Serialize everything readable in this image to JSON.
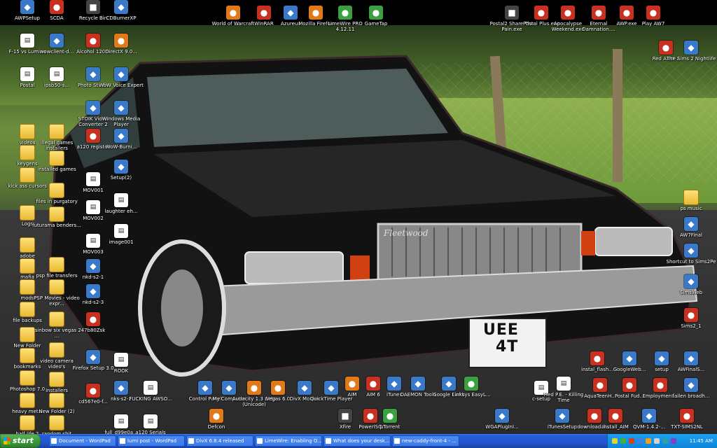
{
  "desktop": {
    "icons_left": [
      {
        "label": "AWPSetup",
        "kind": "app"
      },
      {
        "label": "SCDA",
        "kind": "red"
      },
      {
        "label": "Recycle Bin",
        "kind": "dark"
      },
      {
        "label": "CDBurnerXP",
        "kind": "app"
      },
      {
        "label": "F-15 vs Lumina",
        "kind": "doc"
      },
      {
        "label": "wowclient-d...",
        "kind": "app"
      },
      {
        "label": "Alcohol 120%",
        "kind": "red"
      },
      {
        "label": "DirectX 9.0...",
        "kind": "orange"
      },
      {
        "label": "Postal",
        "kind": "doc"
      },
      {
        "label": "ipsb50-s...",
        "kind": "doc"
      },
      {
        "label": "Photo Studio",
        "kind": "app"
      },
      {
        "label": "WoW Voice Expert",
        "kind": "app"
      },
      {
        "label": "videos",
        "kind": "folder"
      },
      {
        "label": "illegal games installers",
        "kind": "folder"
      },
      {
        "label": "STOIK Video Converter 2",
        "kind": "app"
      },
      {
        "label": "Windows Media Player",
        "kind": "app"
      },
      {
        "label": "a120 register",
        "kind": "red"
      },
      {
        "label": "WoW-Burni...",
        "kind": "app"
      },
      {
        "label": "keygens",
        "kind": "folder"
      },
      {
        "label": "installed games",
        "kind": "folder"
      },
      {
        "label": "Setup(2)",
        "kind": "app"
      },
      {
        "label": "kick ass cursors",
        "kind": "folder"
      },
      {
        "label": "files in purgatory",
        "kind": "folder"
      },
      {
        "label": "MOV001",
        "kind": "doc"
      },
      {
        "label": "laughter eh...",
        "kind": "doc"
      },
      {
        "label": "Logs",
        "kind": "folder"
      },
      {
        "label": "futurama benders...",
        "kind": "folder"
      },
      {
        "label": "MOV002",
        "kind": "doc"
      },
      {
        "label": "adobe",
        "kind": "folder"
      },
      {
        "label": "MOV003",
        "kind": "doc"
      },
      {
        "label": "image001",
        "kind": "doc"
      },
      {
        "label": "mafia",
        "kind": "folder"
      },
      {
        "label": "psp file transfers",
        "kind": "folder"
      },
      {
        "label": "nkd-s2-1",
        "kind": "app"
      },
      {
        "label": "mods",
        "kind": "folder"
      },
      {
        "label": "PSP Movies - video expr...",
        "kind": "folder"
      },
      {
        "label": "nkd-s2-3",
        "kind": "app"
      },
      {
        "label": "file backups",
        "kind": "folder"
      },
      {
        "label": "rainbow six vegas 2 ...",
        "kind": "folder"
      },
      {
        "label": "47b80Zsk",
        "kind": "red"
      },
      {
        "label": "New Folder",
        "kind": "folder"
      },
      {
        "label": "video camera video's",
        "kind": "folder"
      },
      {
        "label": "bookmarks",
        "kind": "folder"
      },
      {
        "label": "Firefox Setup 3.0",
        "kind": "app"
      },
      {
        "label": "ROOK",
        "kind": "doc"
      },
      {
        "label": "Photoshop 7.0",
        "kind": "folder"
      },
      {
        "label": "installers",
        "kind": "folder"
      },
      {
        "label": "cd567e0-f...",
        "kind": "red"
      },
      {
        "label": "nks-s2-2",
        "kind": "app"
      },
      {
        "label": "FUCKING AWSO...",
        "kind": "doc"
      },
      {
        "label": "heavy metal",
        "kind": "folder"
      },
      {
        "label": "New Folder (2)",
        "kind": "folder"
      },
      {
        "label": "half life 2",
        "kind": "folder"
      },
      {
        "label": "random shit",
        "kind": "folder"
      },
      {
        "label": "full_d99e0a...",
        "kind": "doc"
      },
      {
        "label": "a120 Serials",
        "kind": "doc"
      }
    ],
    "icons_top": [
      {
        "label": "World of Warcraft",
        "kind": "orange"
      },
      {
        "label": "WinRAR",
        "kind": "red"
      },
      {
        "label": "Azureus",
        "kind": "app"
      },
      {
        "label": "Mozilla Firefox",
        "kind": "orange"
      },
      {
        "label": "LimeWire PRO 4.12.11",
        "kind": "green"
      },
      {
        "label": "GameTap",
        "kind": "green"
      },
      {
        "label": "Postal2 Share The Pain.exe",
        "kind": "dark"
      },
      {
        "label": "Postal Plus.exe",
        "kind": "red"
      },
      {
        "label": "Apocalypse Weekend.exe",
        "kind": "red"
      },
      {
        "label": "Eternal Damnation....",
        "kind": "red"
      },
      {
        "label": "AWP.exe",
        "kind": "red"
      },
      {
        "label": "Play AW7",
        "kind": "red"
      }
    ],
    "icons_right": [
      {
        "label": "Red Alert 2",
        "kind": "red"
      },
      {
        "label": "The Sims 2 Nightlife",
        "kind": "app"
      },
      {
        "label": "ps music",
        "kind": "folder"
      },
      {
        "label": "AW7Final",
        "kind": "app"
      },
      {
        "label": "Shortcut to Sims2Pe",
        "kind": "app"
      },
      {
        "label": "SimsWeb",
        "kind": "app"
      },
      {
        "label": "Sims2_1",
        "kind": "red"
      }
    ],
    "icons_bottom": [
      {
        "label": "Control Panel",
        "kind": "app"
      },
      {
        "label": "My Computer",
        "kind": "app"
      },
      {
        "label": "Audacity 1.3 Beta (Unicode)",
        "kind": "orange"
      },
      {
        "label": "Vegas 6.0",
        "kind": "orange"
      },
      {
        "label": "DivX Movies",
        "kind": "app"
      },
      {
        "label": "QuickTime Player",
        "kind": "app"
      },
      {
        "label": "AIM",
        "kind": "orange"
      },
      {
        "label": "AIM 6",
        "kind": "red"
      },
      {
        "label": "iTunes",
        "kind": "app"
      },
      {
        "label": "DAEMON Tools",
        "kind": "app"
      },
      {
        "label": "Google Earth",
        "kind": "app"
      },
      {
        "label": "Linksys EasyL...",
        "kind": "green"
      },
      {
        "label": "c-setup",
        "kind": "doc"
      },
      {
        "label": "Hed P.E. - Killing Time",
        "kind": "doc"
      },
      {
        "label": "instal_flash...",
        "kind": "red"
      },
      {
        "label": "GoogleWeb...",
        "kind": "app"
      },
      {
        "label": "setup",
        "kind": "app"
      },
      {
        "label": "AWFinalS...",
        "kind": "app"
      },
      {
        "label": "AquaTeenH...",
        "kind": "red"
      },
      {
        "label": "Postal Fud...",
        "kind": "red"
      },
      {
        "label": "Employment...",
        "kind": "red"
      },
      {
        "label": "fallen broadh...",
        "kind": "app"
      },
      {
        "label": "Defcon",
        "kind": "orange"
      },
      {
        "label": "Xfire",
        "kind": "dark"
      },
      {
        "label": "PowerISO",
        "kind": "red"
      },
      {
        "label": "µTorrent",
        "kind": "green"
      },
      {
        "label": "WGAPlugInI...",
        "kind": "app"
      },
      {
        "label": "iTunesSetup",
        "kind": "app"
      },
      {
        "label": "downloadab...",
        "kind": "red"
      },
      {
        "label": "Install_AIM",
        "kind": "red"
      },
      {
        "label": "QVM-1.4.2-...",
        "kind": "app"
      },
      {
        "label": "TXT-SIMS2NL",
        "kind": "red"
      }
    ]
  },
  "taskbar": {
    "start_label": "start",
    "tasks": [
      {
        "label": "Document - WordPad"
      },
      {
        "label": "lumi post - WordPad"
      },
      {
        "label": "DivX 6.8.4 released"
      },
      {
        "label": "LimeWire: Enabling O..."
      },
      {
        "label": "What does your desk..."
      },
      {
        "label": "new-caddy-front-4 - ..."
      }
    ],
    "clock": "11:45 AM"
  },
  "wallpaper": {
    "plate_line1": "UEE",
    "plate_line2": "4T",
    "grille_script": "Fleetwood"
  },
  "colors": {
    "folder": "#f0c840",
    "taskbar": "#245edb",
    "start": "#3a9a3a",
    "tray": "#0f84d8"
  }
}
